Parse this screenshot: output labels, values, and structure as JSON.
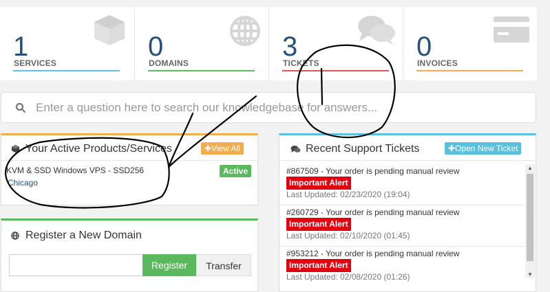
{
  "stats": [
    {
      "count": "1",
      "label": "SERVICES",
      "icon": "cube-icon",
      "color": "#5bc0de"
    },
    {
      "count": "0",
      "label": "DOMAINS",
      "icon": "globe-icon",
      "color": "#5cb85c"
    },
    {
      "count": "3",
      "label": "TICKETS",
      "icon": "comments-icon",
      "color": "#d9534f"
    },
    {
      "count": "0",
      "label": "INVOICES",
      "icon": "credit-card-icon",
      "color": "#f0ad4e"
    }
  ],
  "search": {
    "placeholder": "Enter a question here to search our knowledgebase for answers..."
  },
  "products_panel": {
    "title": "Your Active Products/Services",
    "view_all": "View All",
    "item": {
      "name": "KVM & SSD Windows VPS - SSD256",
      "location": "Chicago",
      "status": "Active"
    },
    "accent": "#f0ad4e"
  },
  "domain_panel": {
    "title": "Register a New Domain",
    "register": "Register",
    "transfer": "Transfer",
    "accent": "#5cb85c"
  },
  "tickets_panel": {
    "title": "Recent Support Tickets",
    "open_new": "Open New Ticket",
    "accent": "#5bc0de",
    "tickets": [
      {
        "subject": "#867509 - Your order is pending manual review",
        "badge": "Important Alert",
        "updated": "Last Updated: 02/23/2020 (19:04)"
      },
      {
        "subject": "#260729 - Your order is pending manual review",
        "badge": "Important Alert",
        "updated": "Last Updated: 02/10/2020 (01:45)"
      },
      {
        "subject": "#953212 - Your order is pending manual review",
        "badge": "Important Alert",
        "updated": "Last Updated: 02/08/2020 (01:26)"
      }
    ]
  }
}
